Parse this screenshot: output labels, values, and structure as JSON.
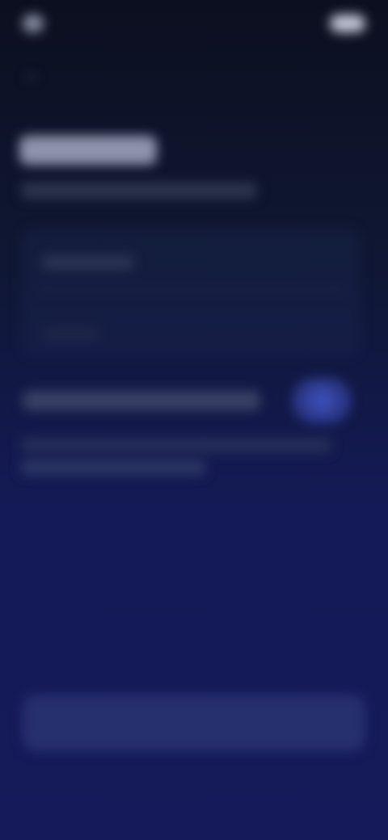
{
  "status_bar": {
    "left_text": "",
    "right_text": ""
  },
  "header": {
    "title": "",
    "subtitle": ""
  },
  "card": {
    "row1_label": "",
    "row2_label": ""
  },
  "toggle": {
    "label": "",
    "state": "on"
  },
  "description": {
    "line1": "",
    "line2": ""
  },
  "primary_button": {
    "label": ""
  },
  "colors": {
    "background_top": "#0c0f1f",
    "background_bottom": "#151a5a",
    "accent": "#2d3a8c"
  },
  "icons": {
    "back": "back-arrow-icon"
  }
}
